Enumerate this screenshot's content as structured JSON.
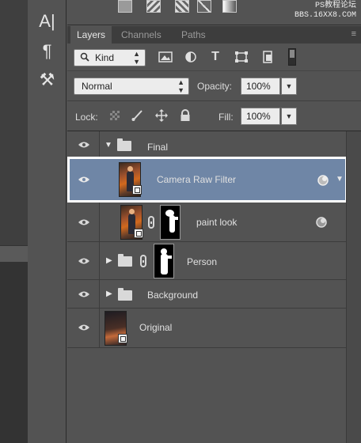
{
  "watermark": {
    "line1": "PS教程论坛",
    "line2": "BBS.16XX8.COM"
  },
  "tools": {
    "type_tool": "A|",
    "paragraph_tool": "¶",
    "brush_tool": "⚒"
  },
  "tabs": [
    {
      "label": "Layers",
      "active": true
    },
    {
      "label": "Channels",
      "active": false
    },
    {
      "label": "Paths",
      "active": false
    }
  ],
  "panel_menu_icon": "≡",
  "filter": {
    "kind_label": "Kind",
    "type_icon": "T"
  },
  "blend": {
    "mode": "Normal",
    "opacity_label": "Opacity:",
    "opacity_value": "100%"
  },
  "lock": {
    "label": "Lock:",
    "fill_label": "Fill:",
    "fill_value": "100%"
  },
  "layers": [
    {
      "name": "Final",
      "type": "group",
      "expanded": true
    },
    {
      "name": "Camera Raw Filter",
      "type": "smart-object",
      "selected": true
    },
    {
      "name": "paint look",
      "type": "smart-object-with-mask"
    },
    {
      "name": "Person",
      "type": "group-with-mask",
      "expanded": false
    },
    {
      "name": "Background",
      "type": "group",
      "expanded": false
    },
    {
      "name": "Original",
      "type": "smart-object"
    }
  ],
  "colors": {
    "selection": "#6f86a6",
    "panel": "#535353",
    "highlight_border": "#ffffff"
  }
}
